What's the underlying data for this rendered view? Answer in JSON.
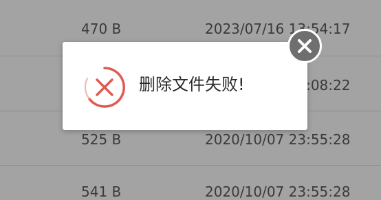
{
  "file_rows": [
    {
      "size": "470 B",
      "date": "2023/07/16 13:54:17"
    },
    {
      "size": "",
      "date": "2023/07/16 13:08:22"
    },
    {
      "size": "525 B",
      "date": "2020/10/07 23:55:28"
    },
    {
      "size": "541 B",
      "date": "2020/10/07 23:55:28"
    }
  ],
  "dialog": {
    "message": "删除文件失败!",
    "icon": "error-circle-x-icon",
    "close_icon": "close-icon"
  },
  "colors": {
    "error_red": "#e05a4f",
    "overlay_gray": "#a3a3a3",
    "close_button_gray": "#6f6f6f"
  }
}
